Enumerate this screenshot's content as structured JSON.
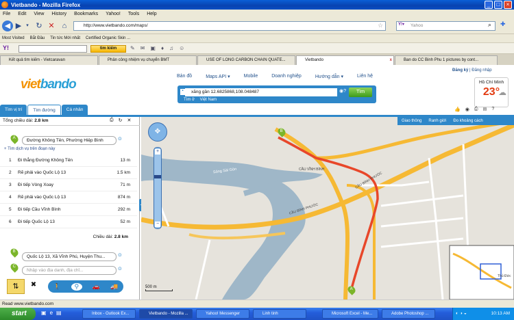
{
  "window": {
    "title": "Vietbando - Mozilla Firefox"
  },
  "menu": [
    "File",
    "Edit",
    "View",
    "History",
    "Bookmarks",
    "Yahoo!",
    "Tools",
    "Help"
  ],
  "nav": {
    "url": "http://www.vietbando.com/maps/",
    "search_placeholder": "Yahoo"
  },
  "bookmarks": [
    "Most Visited",
    "Bắt Đầu",
    "Tin tức Mới nhất",
    "Certified Organic Skin ..."
  ],
  "yahoo": {
    "search_button": "tìm kiếm"
  },
  "tabs": [
    {
      "label": "Kết quả tìm kiếm - Vietcaravan",
      "active": false
    },
    {
      "label": "Phân công nhiệm vụ chuyển BMT",
      "active": false
    },
    {
      "label": "USE OF LONG CARBON CHAIN QUATE...",
      "active": false
    },
    {
      "label": "Vietbando",
      "active": true
    },
    {
      "label": "Ban do CC Binh Phu 1 pictures by cont...",
      "active": false
    }
  ],
  "site": {
    "logo_a": "viet",
    "logo_b": "bando",
    "nav": [
      "Bản đồ",
      "Maps API ▾",
      "Mobile",
      "Doanh nghiệp",
      "Hướng dẫn ▾",
      "Liên hệ"
    ],
    "register": "Đăng ký",
    "login": "Đăng nhập",
    "weather_city": "Hồ Chí Minh",
    "weather_temp": "23°",
    "search_value": "xăng gần 12.6825868,108.048487",
    "search_button": "Tìm",
    "search_option_a": "Tìm ở",
    "search_option_b": "Việt Nam",
    "left_tabs": [
      "Tìm vị trí",
      "Tìm đường",
      "Cá nhân"
    ]
  },
  "route": {
    "total_label": "Tổng chiều dài:",
    "total": "2.8 km",
    "start": "Đường Không Tên, Phường Hiệp Bình",
    "start_service": "Tìm dịch vụ trên đoạn này",
    "steps": [
      {
        "n": "1",
        "text": "Đi thẳng Đường Không Tên",
        "dist": "13 m"
      },
      {
        "n": "2",
        "text": "Rẽ phải vào Quốc Lộ 13",
        "dist": "1.5 km"
      },
      {
        "n": "3",
        "text": "Đi tiếp Vòng Xoay",
        "dist": "71 m"
      },
      {
        "n": "4",
        "text": "Rẽ phải vào Quốc Lộ 13",
        "dist": "874 m"
      },
      {
        "n": "5",
        "text": "Đi tiếp Cầu Vĩnh Bình",
        "dist": "292 m"
      },
      {
        "n": "6",
        "text": "Đi tiếp Quốc Lộ 13",
        "dist": "52 m"
      }
    ],
    "length_label": "Chiều dài:",
    "length": "2.8 km",
    "end": "Quốc Lộ 13, Xã Vĩnh Phú, Huyện Thu...",
    "via_placeholder": "Nhập vào địa danh, địa chỉ..."
  },
  "map": {
    "tools": [
      "Giao thông",
      "Ranh giới",
      "Đo khoảng cách"
    ],
    "labels": {
      "river": "Sông Sài Gòn",
      "bridge_a": "CẦU VĨNH BÌNH",
      "bridge_b": "CẦU BÌNH PHƯỚC",
      "bridge_c": "CẦU BÌNH PHƯỚC",
      "inset": "Thủ Đức"
    },
    "scale": "500 m"
  },
  "status": "Read www.vietbando.com",
  "taskbar": {
    "start": "start",
    "items": [
      "Inbox - Outlook Ex...",
      "Vietbando - Mozilla ...",
      "Yahoo! Messenger",
      "Linh tinh",
      "Microsoft Excel - Me...",
      "Adobe Photoshop ..."
    ],
    "time": "10:13 AM"
  }
}
